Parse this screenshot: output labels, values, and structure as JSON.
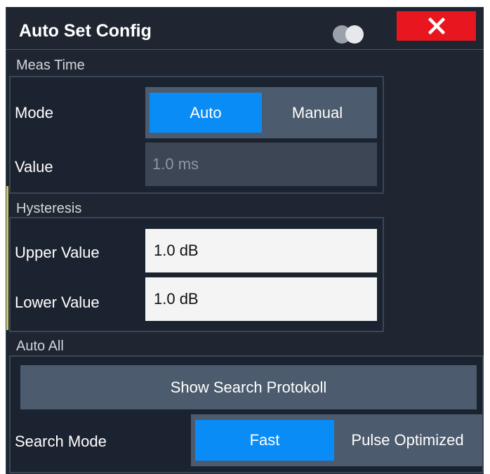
{
  "dialog": {
    "title": "Auto Set Config",
    "close_label": "close"
  },
  "meas_time": {
    "section_label": "Meas Time",
    "mode_label": "Mode",
    "mode_options": [
      "Auto",
      "Manual"
    ],
    "mode_selected": "Auto",
    "value_label": "Value",
    "value": "1.0 ms"
  },
  "hysteresis": {
    "section_label": "Hysteresis",
    "upper_label": "Upper Value",
    "upper_value": "1.0 dB",
    "lower_label": "Lower Value",
    "lower_value": "1.0 dB"
  },
  "auto_all": {
    "section_label": "Auto All",
    "show_protocol_label": "Show Search Protokoll",
    "search_mode_label": "Search Mode",
    "search_mode_options": [
      "Fast",
      "Pulse Optimized"
    ],
    "search_mode_selected": "Fast"
  },
  "colors": {
    "accent": "#0a8cf7",
    "close": "#e8171f",
    "background": "#1f2631"
  }
}
